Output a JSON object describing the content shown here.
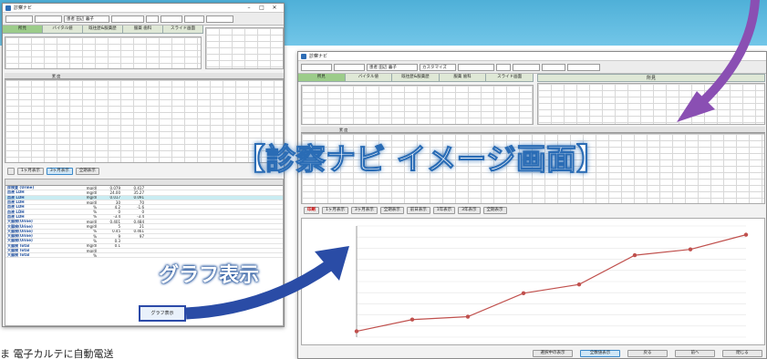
{
  "banner": {
    "title": "【診察ナビ イメージ画面】",
    "graph_label": "グラフ表示",
    "bottom_text": "ま 電子カルテに自動電送"
  },
  "colors": {
    "band": "#5bb8de",
    "arrow": "#2a4ca6",
    "arrow_purple": "#8a4fb3",
    "line": "#c0504d",
    "tab_selected": "#9ccc8a"
  },
  "back_window": {
    "title": "診察ナビ",
    "window_controls": [
      "–",
      "□",
      "✕"
    ],
    "toolbar": {
      "patient_name": "患者 田辺 暮子"
    },
    "tabs": [
      "所見",
      "バイタル値",
      "既往歴&服薬歴",
      "服薬 歯科",
      "スライド画面"
    ],
    "totals_header": "累 度",
    "range_tabs": [
      "1ヶ月表示",
      "3ヶ月表示",
      "全期表示"
    ],
    "lab_rows": [
      {
        "name": "尿検査 (Urine)",
        "unit": "mg/dl",
        "v1": "0.079",
        "v2": "0.417",
        "hl": false
      },
      {
        "name": "血液 LDH",
        "unit": "mg/dl",
        "v1": "24.00",
        "v2": "35.27",
        "hl": false
      },
      {
        "name": "血液 LDH",
        "unit": "mg/dl",
        "v1": "0.017",
        "v2": "0.091",
        "hl": true
      },
      {
        "name": "血液 LDH",
        "unit": "mg/dl",
        "v1": "30",
        "v2": "70",
        "hl": false
      },
      {
        "name": "血液 LDH",
        "unit": "%",
        "v1": "4.2",
        "v2": "-1.6",
        "hl": false
      },
      {
        "name": "血液 LDH",
        "unit": "%",
        "v1": "0",
        "v2": "0",
        "hl": false
      },
      {
        "name": "血液 LDH",
        "unit": "%",
        "v1": "-3.4",
        "v2": "-3.4",
        "hl": false
      },
      {
        "name": "大腸検(Urine)",
        "unit": "mg/dl",
        "v1": "0.401",
        "v2": "0.484",
        "hl": false
      },
      {
        "name": "大腸検(Urine)",
        "unit": "mg/dl",
        "v1": "5",
        "v2": "21",
        "hl": false
      },
      {
        "name": "大腸検(Urine)",
        "unit": "%",
        "v1": "0.45",
        "v2": "0.461",
        "hl": false
      },
      {
        "name": "大腸検(Urine)",
        "unit": "%",
        "v1": "9",
        "v2": "97",
        "hl": false
      },
      {
        "name": "大腸検(Urine)",
        "unit": "%",
        "v1": "0.3",
        "v2": "",
        "hl": false
      },
      {
        "name": "大腸検 Total",
        "unit": "mg/dl",
        "v1": "0.1",
        "v2": "",
        "hl": false
      },
      {
        "name": "大腸検 Total",
        "unit": "mg/dl",
        "v1": "",
        "v2": "",
        "hl": false
      },
      {
        "name": "大腸検 Total",
        "unit": "%",
        "v1": "",
        "v2": "",
        "hl": false
      }
    ],
    "graph_button": "グラフ表示"
  },
  "front_window": {
    "title": "診察ナビ",
    "toolbar": {
      "patient_name": "患者 田辺 暮子",
      "tab_label": "カスタマイズ"
    },
    "tabs": [
      "所見",
      "バイタル値",
      "既往歴&服薬歴",
      "服薬 歯科",
      "スライド画面"
    ],
    "side_header": "所見",
    "totals_header": "累 度",
    "range_buttons": [
      "印刷",
      "1ヶ月表示",
      "3ヶ月表示",
      "全期表示",
      "前日表示",
      "1年表示",
      "3年表示",
      "全期表示"
    ],
    "bottom_buttons": [
      "選択中の表示",
      "全数値表示",
      "戻る",
      "前へ",
      "閉じる"
    ]
  },
  "chart_data": {
    "type": "line",
    "title": "",
    "xlabel": "",
    "ylabel": "",
    "x": [
      1,
      2,
      3,
      4,
      5,
      6,
      7,
      8
    ],
    "series": [
      {
        "values": [
          96.0,
          96.4,
          96.5,
          97.3,
          97.6,
          98.6,
          98.8,
          99.3
        ]
      }
    ],
    "ylim": [
      95.8,
      99.6
    ],
    "grid": true
  }
}
